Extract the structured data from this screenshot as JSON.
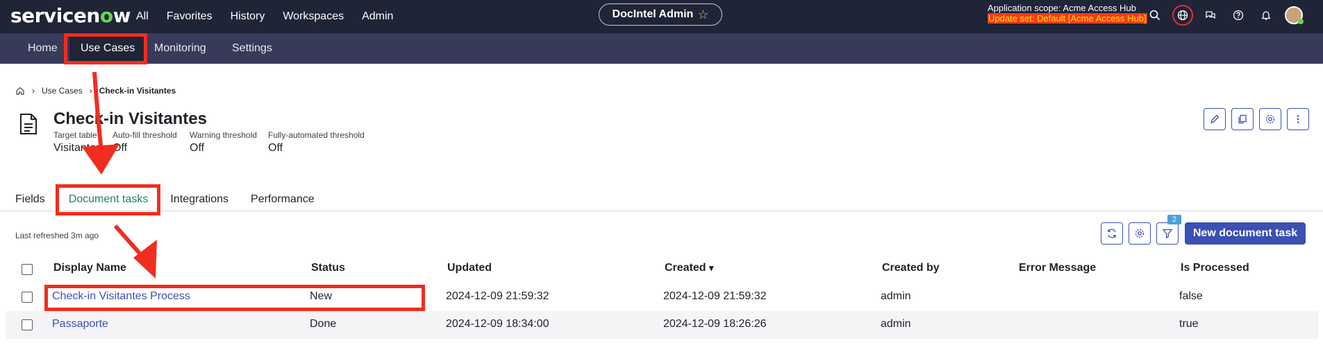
{
  "topbar": {
    "logo_pre": "servicen",
    "logo_o": "o",
    "logo_post": "w",
    "nav": [
      "All",
      "Favorites",
      "History",
      "Workspaces",
      "Admin"
    ],
    "scope_pill": "DocIntel Admin",
    "app_scope": "Application scope: Acme Access Hub",
    "update_set": "Update set: Default [Acme Access Hub]"
  },
  "subnav": {
    "tabs": [
      "Home",
      "Use Cases",
      "Monitoring",
      "Settings"
    ],
    "active": "Use Cases"
  },
  "breadcrumb": {
    "items": [
      "Use Cases",
      "Check-in Visitantes"
    ]
  },
  "record": {
    "title": "Check-in Visitantes",
    "fields": [
      {
        "label": "Target table",
        "value": "Visitantes"
      },
      {
        "label": "Auto-fill threshold",
        "value": "Off"
      },
      {
        "label": "Warning threshold",
        "value": "Off"
      },
      {
        "label": "Fully-automated threshold",
        "value": "Off"
      }
    ]
  },
  "tabs": {
    "items": [
      "Fields",
      "Document tasks",
      "Integrations",
      "Performance"
    ],
    "active": "Document tasks"
  },
  "list": {
    "last_refreshed": "Last refreshed 3m ago",
    "filter_count": "2",
    "new_button": "New document task",
    "columns": [
      "Display Name",
      "Status",
      "Updated",
      "Created",
      "Created by",
      "Error Message",
      "Is Processed"
    ],
    "sort_indicator": "▾",
    "rows": [
      {
        "name": "Check-in Visitantes Process",
        "status": "New",
        "updated": "2024-12-09 21:59:32",
        "created": "2024-12-09 21:59:32",
        "created_by": "admin",
        "error": "",
        "processed": "false"
      },
      {
        "name": "Passaporte",
        "status": "Done",
        "updated": "2024-12-09 18:34:00",
        "created": "2024-12-09 18:26:26",
        "created_by": "admin",
        "error": "",
        "processed": "true"
      }
    ]
  },
  "colors": {
    "topbar": "#202437",
    "subbar": "#373b59",
    "accent": "#3c4fb3",
    "highlight": "#f12d1f",
    "active_tab": "#1c8262"
  }
}
